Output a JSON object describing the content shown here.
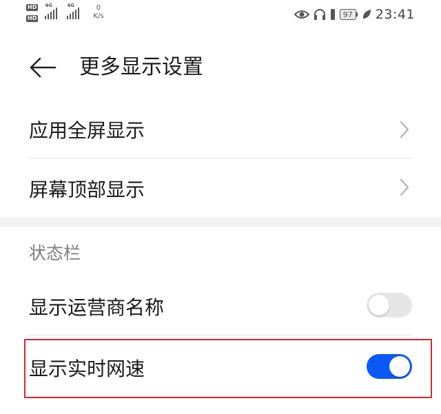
{
  "status_bar": {
    "sim1_badge": "HD",
    "sim2_badge": "HD",
    "sim1_network": "4G",
    "sim2_network": "4G",
    "net_speed_value": "0",
    "net_speed_unit": "K/s",
    "battery_level": "97",
    "time": "23:41",
    "icons": [
      "eye-icon",
      "headphones-icon",
      "battery-icon",
      "leaf-icon"
    ]
  },
  "header": {
    "title": "更多显示设置",
    "back_icon": "arrow-left-icon"
  },
  "menu_items": [
    {
      "label": "应用全屏显示",
      "icon": "chevron-right-icon"
    },
    {
      "label": "屏幕顶部显示",
      "icon": "chevron-right-icon"
    }
  ],
  "status_section": {
    "header": "状态栏",
    "toggles": [
      {
        "label": "显示运营商名称",
        "on": false
      },
      {
        "label": "显示实时网速",
        "on": true
      }
    ]
  },
  "colors": {
    "accent": "#0a59f7",
    "toggle_off": "#e6e6e6",
    "highlight_border": "#d7262d",
    "section_text": "#7e7e7e"
  }
}
